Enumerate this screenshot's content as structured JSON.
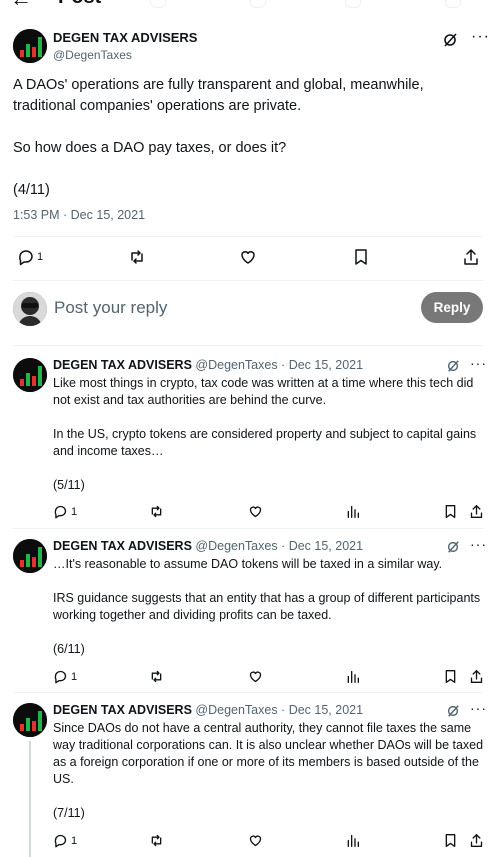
{
  "header": {
    "back_icon": "arrow-left-icon",
    "title": "Post"
  },
  "main_tweet": {
    "author": "DEGEN TAX ADVISERS",
    "handle": "@DegenTaxes",
    "paragraphs": [
      "A DAOs' operations are fully transparent and global, meanwhile, traditional companies' operations are private.",
      "So how does a DAO pay taxes, or does it?",
      "(4/11)"
    ],
    "timestamp": "1:53 PM · Dec 15, 2021",
    "reply_count": "1"
  },
  "reply_box": {
    "placeholder": "Post your reply",
    "button_label": "Reply"
  },
  "thread": [
    {
      "author": "DEGEN TAX ADVISERS",
      "meta": "@DegenTaxes · Dec 15, 2021",
      "paragraphs": [
        "Like most things in crypto, tax code was written at a time where this tech did not exist and tax authorities are behind the curve.",
        "In the US, crypto tokens are considered property and subject to capital gains and income taxes…",
        "(5/11)"
      ],
      "reply_count": "1"
    },
    {
      "author": "DEGEN TAX ADVISERS",
      "meta": "@DegenTaxes · Dec 15, 2021",
      "paragraphs": [
        "…It's reasonable to assume DAO tokens will be taxed in a similar way.",
        "IRS guidance suggests that an entity that has a group of different participants working together and dividing profits can be taxed.",
        "(6/11)"
      ],
      "reply_count": "1"
    },
    {
      "author": "DEGEN TAX ADVISERS",
      "meta": "@DegenTaxes · Dec 15, 2021",
      "paragraphs": [
        "Since DAOs do not have a central authority, they cannot file taxes the same way traditional corporations can. It is also unclear whether DAOs will be taxed as a foreign corporation if one or more of its members is based outside of the US.",
        "(7/11)"
      ],
      "reply_count": "1"
    }
  ],
  "colors": {
    "text": "#0f1419",
    "muted": "#536471",
    "reply_button": "#787878",
    "logo_green": "#22b34a",
    "logo_red": "#e2332c"
  }
}
